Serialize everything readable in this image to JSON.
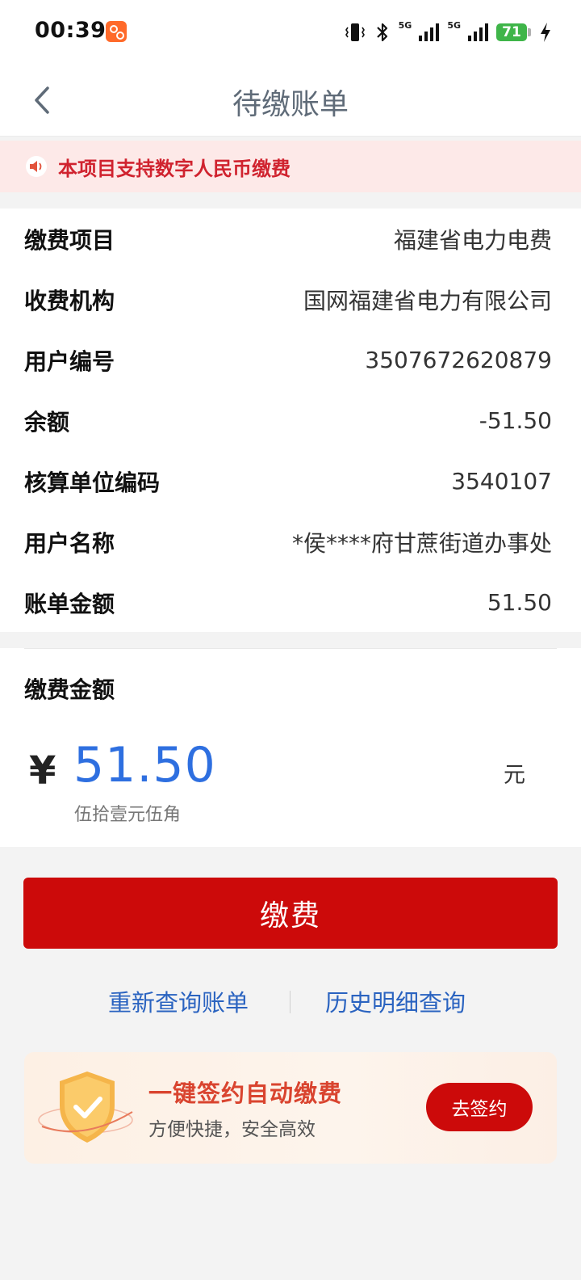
{
  "status_bar": {
    "time": "00:39",
    "network_1": "5G",
    "network_2": "5G",
    "battery": "71"
  },
  "nav": {
    "title": "待缴账单"
  },
  "notice": {
    "text": "本项目支持数字人民币缴费"
  },
  "bill_info": {
    "rows": [
      {
        "label": "缴费项目",
        "value": "福建省电力电费"
      },
      {
        "label": "收费机构",
        "value": "国网福建省电力有限公司"
      },
      {
        "label": "用户编号",
        "value": "3507672620879"
      },
      {
        "label": "余额",
        "value": "-51.50"
      },
      {
        "label": "核算单位编码",
        "value": "3540107"
      },
      {
        "label": "用户名称",
        "value": "*侯****府甘蔗街道办事处"
      },
      {
        "label": "账单金额",
        "value": "51.50"
      }
    ]
  },
  "payment": {
    "label": "缴费金额",
    "currency_symbol": "¥",
    "amount": "51.50",
    "amount_chinese": "伍拾壹元伍角",
    "unit": "元"
  },
  "pay_button": {
    "label": "缴费"
  },
  "links": {
    "requery": "重新查询账单",
    "history": "历史明细查询"
  },
  "auto_pay_banner": {
    "title": "一键签约自动缴费",
    "subtitle": "方便快捷，安全高效",
    "button": "去签约"
  },
  "colors": {
    "primary_red": "#cc0a0a",
    "amount_blue": "#2e6fe0",
    "link_blue": "#2a63c0",
    "notice_red": "#d0232f"
  }
}
